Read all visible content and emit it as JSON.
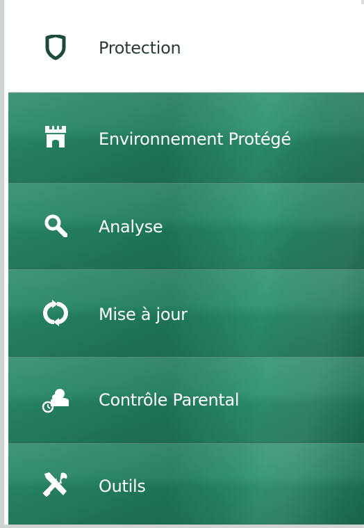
{
  "menu": {
    "items": [
      {
        "label": "Protection",
        "icon": "shield-icon",
        "selected": true
      },
      {
        "label": "Environnement Protégé",
        "icon": "castle-tower-icon",
        "selected": false
      },
      {
        "label": "Analyse",
        "icon": "search-icon",
        "selected": false
      },
      {
        "label": "Mise à jour",
        "icon": "refresh-icon",
        "selected": false
      },
      {
        "label": "Contrôle Parental",
        "icon": "parental-control-icon",
        "selected": false
      },
      {
        "label": "Outils",
        "icon": "tools-icon",
        "selected": false
      }
    ]
  },
  "colors": {
    "selected_bg": "#ffffff",
    "selected_text": "#2d3b36",
    "selected_icon": "#1e4a3c",
    "menu_bg": "#1f7e5f",
    "menu_text": "#ffffff"
  }
}
